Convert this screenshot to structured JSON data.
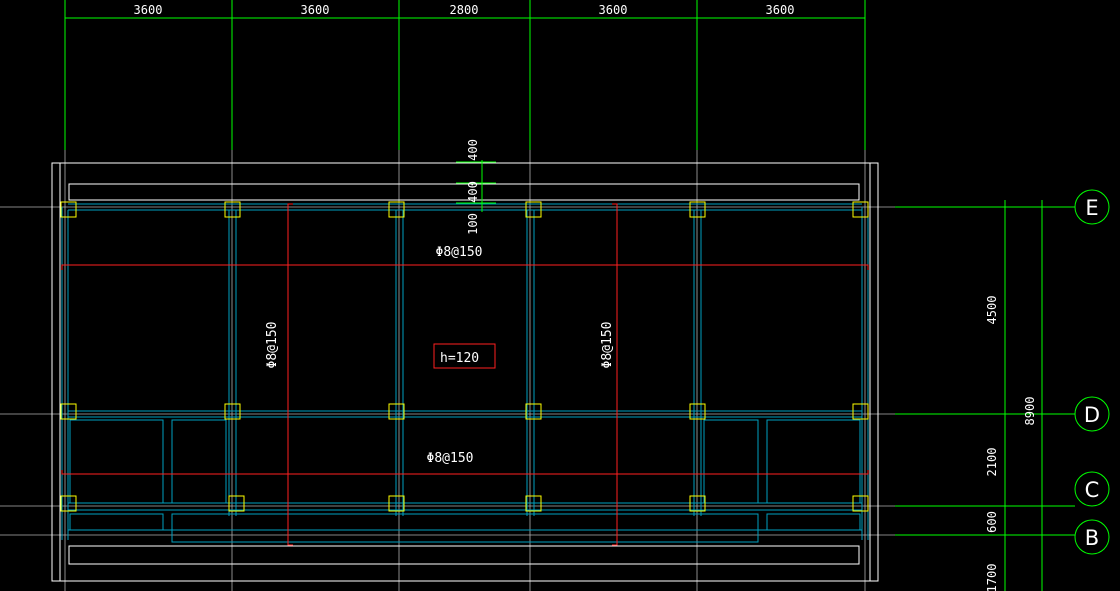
{
  "colors": {
    "background": "#000000",
    "grid": "#00ff00",
    "outline": "#ffffff",
    "beam": "#00a0c0",
    "column": "#ffff00",
    "rebar": "#ff2020",
    "axis_line": "#b0b0b0"
  },
  "top_dimensions": [
    "3600",
    "3600",
    "2800",
    "3600",
    "3600"
  ],
  "slab_dimensions": {
    "upper": "400",
    "middle": "400",
    "lower": "100"
  },
  "right_dimensions": {
    "e_to_d": "4500",
    "d_to_c": "2100",
    "c_to_b": "600",
    "below_b": "1700",
    "total": "8900"
  },
  "axes": [
    "E",
    "D",
    "C",
    "B"
  ],
  "rebar_labels": {
    "top_horizontal": "Φ8@150",
    "bottom_horizontal": "Φ8@150",
    "left_vertical": "Φ8@150",
    "right_vertical": "Φ8@150"
  },
  "slab_thickness": "h=120"
}
